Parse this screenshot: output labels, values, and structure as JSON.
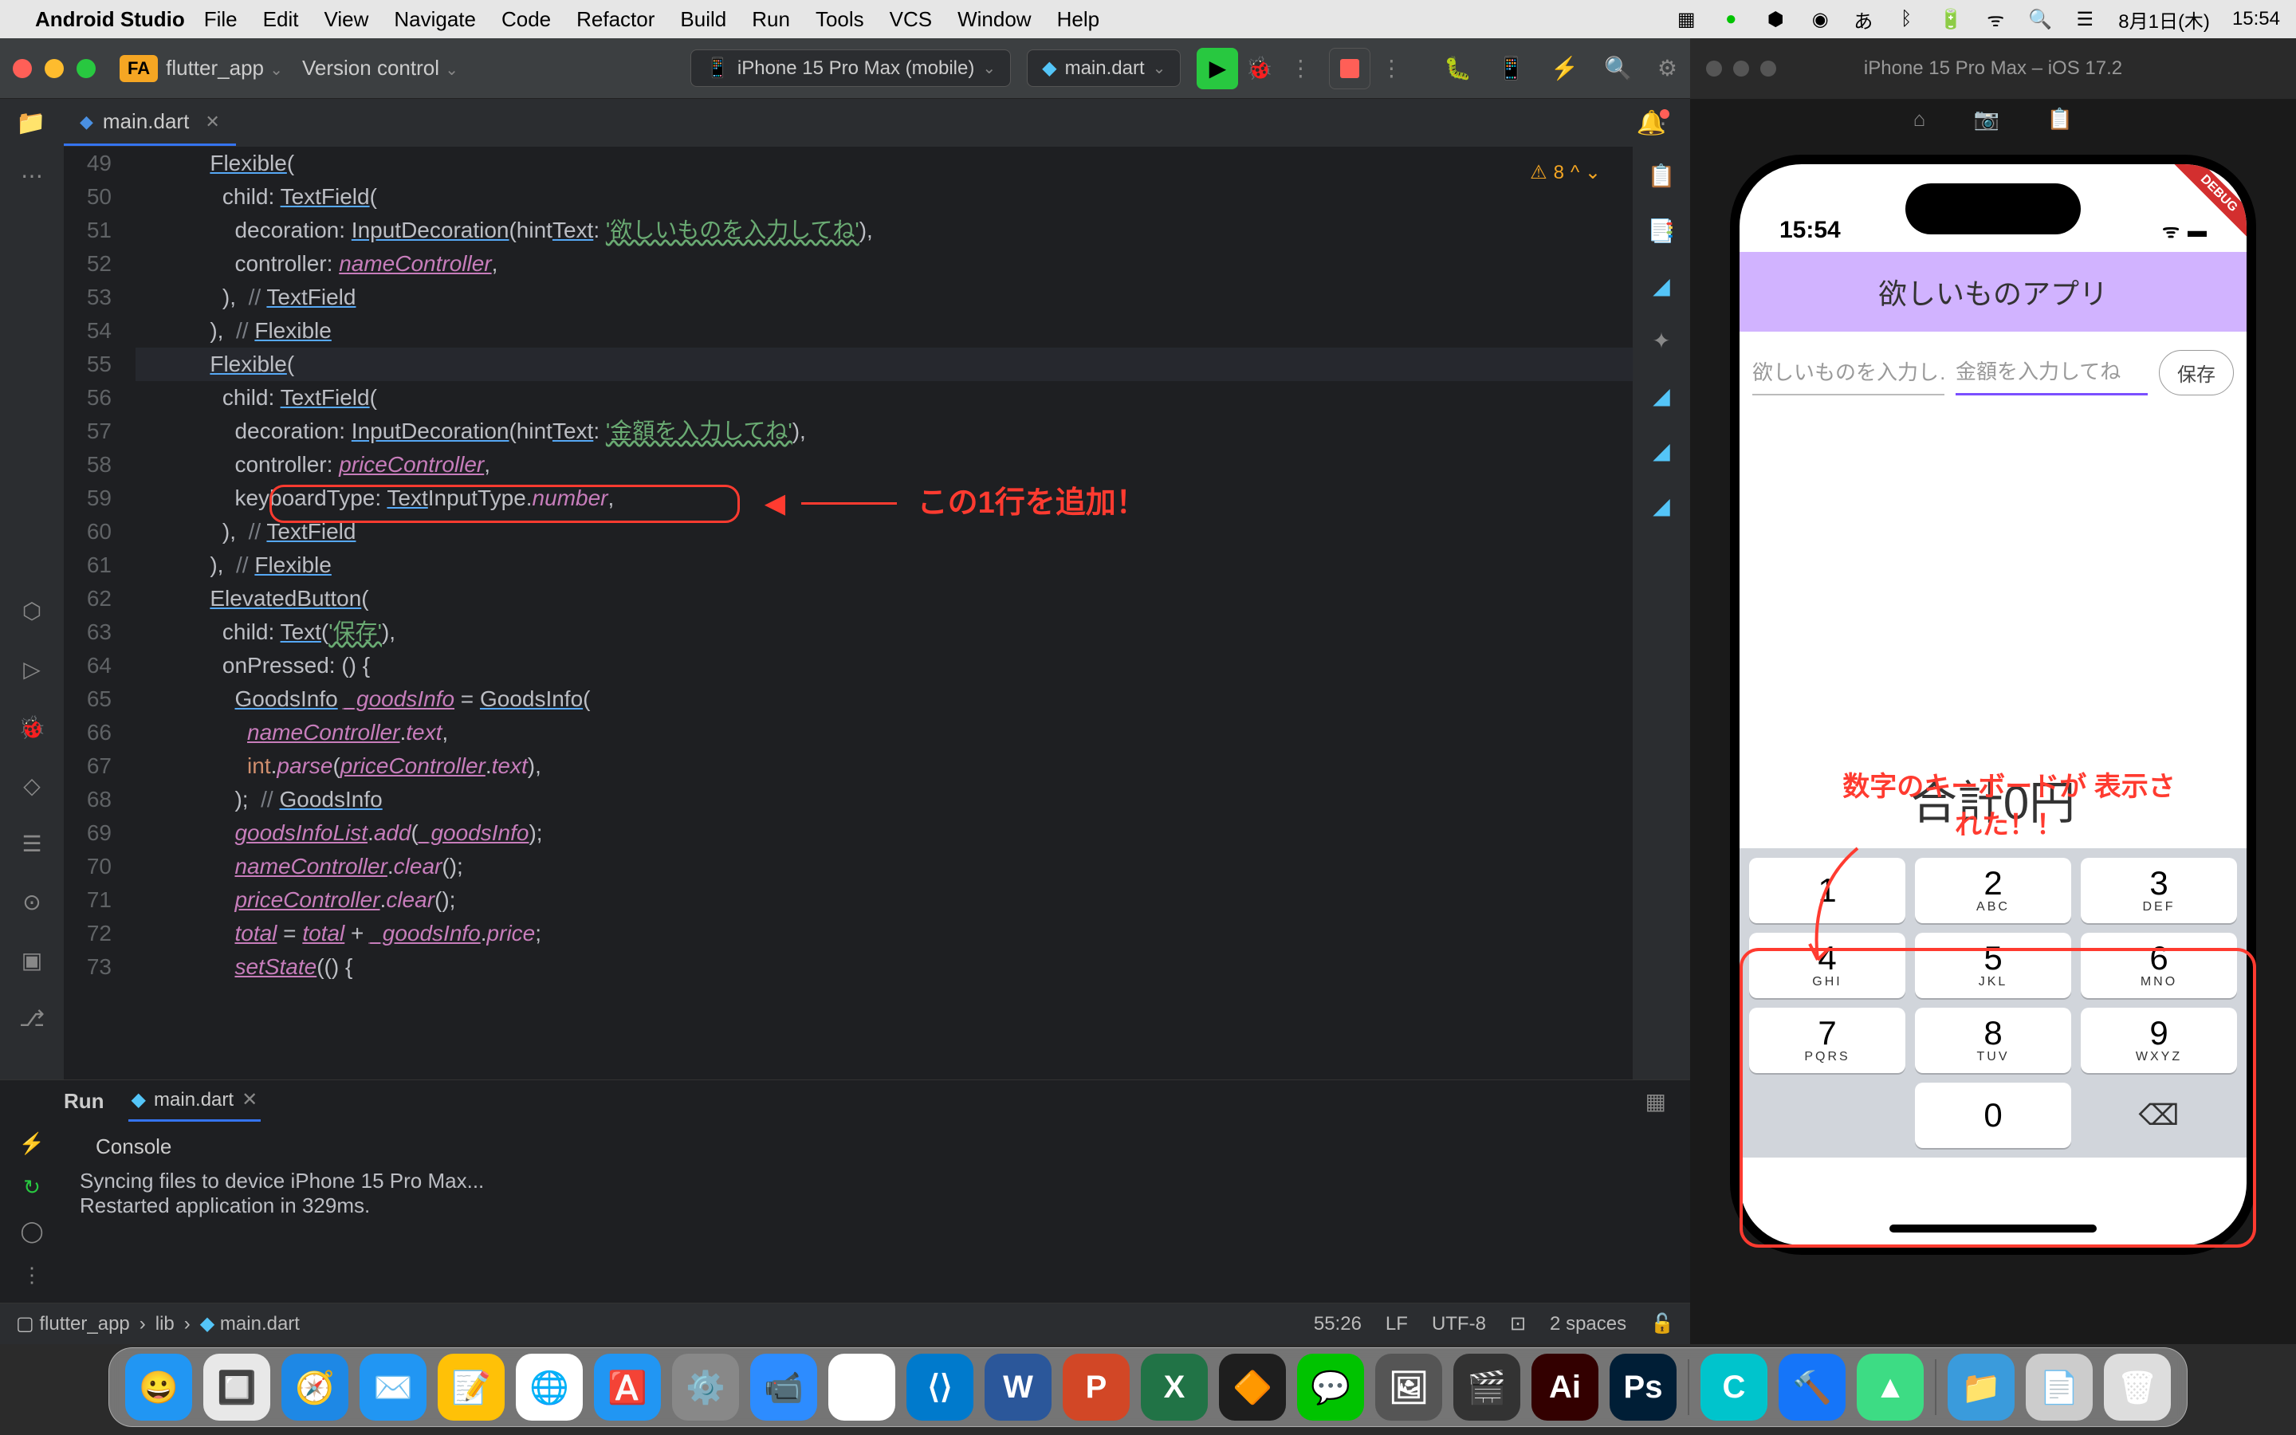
{
  "macos": {
    "app_name": "Android Studio",
    "menus": [
      "File",
      "Edit",
      "View",
      "Navigate",
      "Code",
      "Refactor",
      "Build",
      "Run",
      "Tools",
      "VCS",
      "Window",
      "Help"
    ],
    "right": {
      "ime": "あ",
      "date": "8月1日(木)",
      "time": "15:54"
    }
  },
  "ide": {
    "project_badge": "FA",
    "project_name": "flutter_app",
    "version_control": "Version control",
    "device": "iPhone 15 Pro Max (mobile)",
    "run_config": "main.dart",
    "tab": "main.dart",
    "warning_count": "8",
    "lines": [
      {
        "n": "49",
        "t": "            Flexible("
      },
      {
        "n": "50",
        "t": "              child: TextField("
      },
      {
        "n": "51",
        "t": "                decoration: InputDecoration(hintText: '欲しいものを入力してね'),"
      },
      {
        "n": "52",
        "t": "                controller: nameController,"
      },
      {
        "n": "53",
        "t": "              ),  // TextField"
      },
      {
        "n": "54",
        "t": "            ),  // Flexible"
      },
      {
        "n": "55",
        "t": "            Flexible("
      },
      {
        "n": "56",
        "t": "              child: TextField("
      },
      {
        "n": "57",
        "t": "                decoration: InputDecoration(hintText: '金額を入力してね'),"
      },
      {
        "n": "58",
        "t": "                controller: priceController,"
      },
      {
        "n": "59",
        "t": "                keyboardType: TextInputType.number,"
      },
      {
        "n": "60",
        "t": "              ),  // TextField"
      },
      {
        "n": "61",
        "t": "            ),  // Flexible"
      },
      {
        "n": "62",
        "t": "            ElevatedButton("
      },
      {
        "n": "63",
        "t": "              child: Text('保存'),"
      },
      {
        "n": "64",
        "t": "              onPressed: () {"
      },
      {
        "n": "65",
        "t": "                GoodsInfo _goodsInfo = GoodsInfo("
      },
      {
        "n": "66",
        "t": "                  nameController.text,"
      },
      {
        "n": "67",
        "t": "                  int.parse(priceController.text),"
      },
      {
        "n": "68",
        "t": "                );  // GoodsInfo"
      },
      {
        "n": "69",
        "t": "                goodsInfoList.add(_goodsInfo);"
      },
      {
        "n": "70",
        "t": "                nameController.clear();"
      },
      {
        "n": "71",
        "t": "                priceController.clear();"
      },
      {
        "n": "72",
        "t": "                total = total + _goodsInfo.price;"
      },
      {
        "n": "73",
        "t": "                setState(() {"
      }
    ],
    "annotation_code": "この1行を追加！",
    "run_panel": {
      "label": "Run",
      "subtab": "main.dart",
      "console_label": "Console",
      "lines": [
        "Syncing files to device iPhone 15 Pro Max...",
        "Restarted application in 329ms."
      ]
    },
    "breadcrumbs": [
      "flutter_app",
      "lib",
      "main.dart"
    ],
    "status": {
      "pos": "55:26",
      "eol": "LF",
      "enc": "UTF-8",
      "indent": "2 spaces"
    }
  },
  "sim": {
    "title": "iPhone 15 Pro Max – iOS 17.2",
    "status_time": "15:54",
    "appbar": "欲しいものアプリ",
    "hint1": "欲しいものを入力し…",
    "hint2": "金額を入力してね",
    "save": "保存",
    "total": "合計0円",
    "kb_label": "数字のキーボードが\n表示された！！",
    "keys": [
      {
        "n": "1",
        "s": ""
      },
      {
        "n": "2",
        "s": "ABC"
      },
      {
        "n": "3",
        "s": "DEF"
      },
      {
        "n": "4",
        "s": "GHI"
      },
      {
        "n": "5",
        "s": "JKL"
      },
      {
        "n": "6",
        "s": "MNO"
      },
      {
        "n": "7",
        "s": "PQRS"
      },
      {
        "n": "8",
        "s": "TUV"
      },
      {
        "n": "9",
        "s": "WXYZ"
      },
      {
        "n": "",
        "s": ""
      },
      {
        "n": "0",
        "s": ""
      },
      {
        "n": "⌫",
        "s": ""
      }
    ]
  },
  "dock": {
    "apps": [
      {
        "name": "finder",
        "bg": "#2196f3",
        "glyph": "😀"
      },
      {
        "name": "launchpad",
        "bg": "#e8e8e8",
        "glyph": "🔲"
      },
      {
        "name": "safari",
        "bg": "#1e88e5",
        "glyph": "🧭"
      },
      {
        "name": "mail",
        "bg": "#2196f3",
        "glyph": "✉️"
      },
      {
        "name": "notes",
        "bg": "#ffc107",
        "glyph": "📝"
      },
      {
        "name": "chrome",
        "bg": "#fff",
        "glyph": "🌐"
      },
      {
        "name": "appstore",
        "bg": "#2196f3",
        "glyph": "🅰️"
      },
      {
        "name": "settings",
        "bg": "#888",
        "glyph": "⚙️"
      },
      {
        "name": "zoom",
        "bg": "#2d8cff",
        "glyph": "📹"
      },
      {
        "name": "slack",
        "bg": "#fff",
        "glyph": "#"
      },
      {
        "name": "vscode",
        "bg": "#007acc",
        "glyph": "⟨⟩"
      },
      {
        "name": "word",
        "bg": "#2b579a",
        "glyph": "W"
      },
      {
        "name": "powerpoint",
        "bg": "#d24726",
        "glyph": "P"
      },
      {
        "name": "excel",
        "bg": "#217346",
        "glyph": "X"
      },
      {
        "name": "figma",
        "bg": "#1e1e1e",
        "glyph": "🔶"
      },
      {
        "name": "line",
        "bg": "#00c300",
        "glyph": "💬"
      },
      {
        "name": "preview",
        "bg": "#555",
        "glyph": "🖼"
      },
      {
        "name": "fcpx",
        "bg": "#333",
        "glyph": "🎬"
      },
      {
        "name": "illustrator",
        "bg": "#330000",
        "glyph": "Ai"
      },
      {
        "name": "photoshop",
        "bg": "#001e36",
        "glyph": "Ps"
      }
    ],
    "apps2": [
      {
        "name": "canva",
        "bg": "#00c4cc",
        "glyph": "C"
      },
      {
        "name": "xcode",
        "bg": "#1575f9",
        "glyph": "🔨"
      },
      {
        "name": "androidstudio",
        "bg": "#3ddc84",
        "glyph": "▲"
      }
    ],
    "apps3": [
      {
        "name": "downloads",
        "bg": "#3a9bdc",
        "glyph": "📁"
      },
      {
        "name": "docs",
        "bg": "#ccc",
        "glyph": "📄"
      },
      {
        "name": "trash",
        "bg": "#ddd",
        "glyph": "🗑"
      }
    ]
  }
}
